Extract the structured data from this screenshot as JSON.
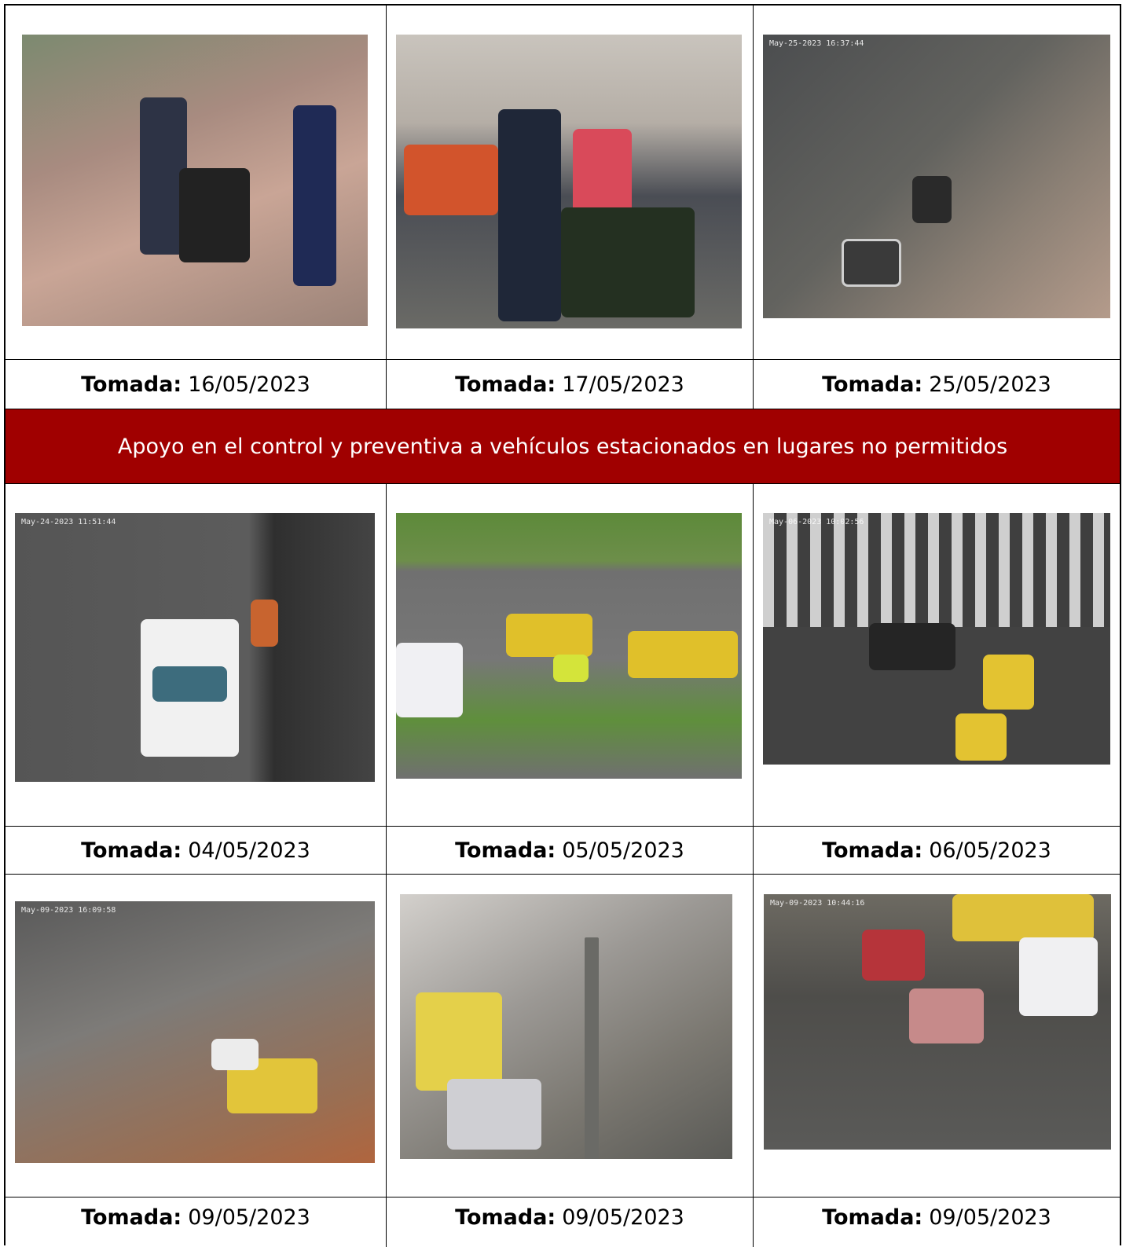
{
  "captions_row1": [
    {
      "label": "Tomada:",
      "date": "16/05/2023"
    },
    {
      "label": "Tomada:",
      "date": "17/05/2023"
    },
    {
      "label": "Tomada:",
      "date": "25/05/2023"
    }
  ],
  "section_banner": "Apoyo en el control y preventiva a vehículos estacionados en lugares no permitidos",
  "captions_row2": [
    {
      "label": "Tomada:",
      "date": "04/05/2023"
    },
    {
      "label": "Tomada:",
      "date": "05/05/2023"
    },
    {
      "label": "Tomada:",
      "date": "06/05/2023"
    }
  ],
  "captions_row3": [
    {
      "label": "Tomada:",
      "date": "09/05/2023"
    },
    {
      "label": "Tomada:",
      "date": "09/05/2023"
    },
    {
      "label": "Tomada:",
      "date": "09/05/2023"
    }
  ],
  "colors": {
    "banner_bg": "#a00000",
    "banner_text": "#ffffff"
  }
}
